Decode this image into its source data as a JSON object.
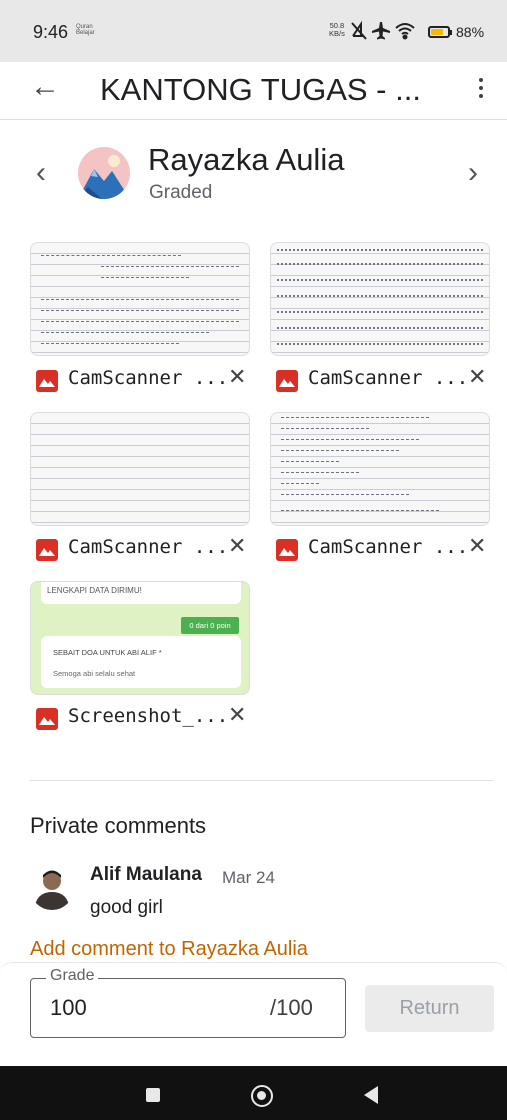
{
  "status_bar": {
    "time": "9:46",
    "mini_label_1": "Quran",
    "mini_label_2": "Belajar",
    "net_speed": "50.8",
    "net_unit": "KB/s",
    "battery_pct": "88%",
    "battery_level": 0.88
  },
  "app_bar": {
    "title": "KANTONG TUGAS - ..."
  },
  "student": {
    "name": "Rayazka Aulia",
    "status": "Graded"
  },
  "attachments": [
    {
      "name": "CamScanner ..."
    },
    {
      "name": "CamScanner ..."
    },
    {
      "name": "CamScanner ..."
    },
    {
      "name": "CamScanner ..."
    },
    {
      "name": "Screenshot_..."
    }
  ],
  "screenshot_preview": {
    "banner": "LENGKAPI DATA DIRIMU!",
    "badge": "0 dari 0 poin",
    "question": "SEBAIT DOA UNTUK ABI ALIF *",
    "answer": "Semoga abi selalu sehat"
  },
  "comments": {
    "heading": "Private comments",
    "items": [
      {
        "author": "Alif Maulana",
        "date": "Mar 24",
        "text": "good girl"
      }
    ],
    "add_comment": "Add comment to Rayazka Aulia"
  },
  "grade": {
    "label": "Grade",
    "value": "100",
    "max": "/100",
    "return_label": "Return"
  },
  "colors": {
    "accent": "#c26401",
    "image_icon": "#d93025",
    "badge_green": "#4caf50"
  }
}
